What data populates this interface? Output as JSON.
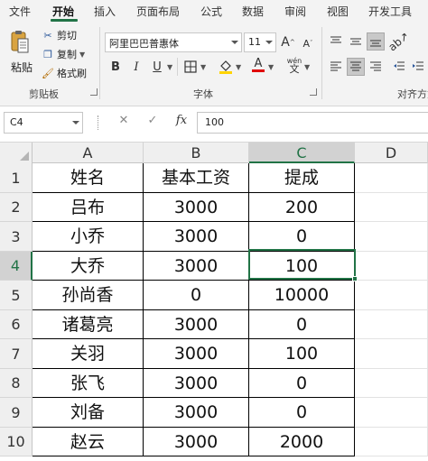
{
  "ribbon_tabs": [
    "文件",
    "开始",
    "插入",
    "页面布局",
    "公式",
    "数据",
    "审阅",
    "视图",
    "开发工具"
  ],
  "active_tab": "开始",
  "clipboard": {
    "paste_label": "粘贴",
    "cut_label": "剪切",
    "copy_label": "复制",
    "format_painter_label": "格式刷",
    "group_label": "剪贴板"
  },
  "font": {
    "font_name": "阿里巴巴普惠体",
    "font_size": "11",
    "grow_label": "A",
    "shrink_label": "A",
    "bold": "B",
    "italic": "I",
    "underline": "U",
    "font_color_label": "A",
    "phonetic_label": "wén",
    "group_label": "字体"
  },
  "alignment": {
    "group_label": "对齐方式"
  },
  "formula_bar": {
    "name_box": "C4",
    "cancel_glyph": "✕",
    "enter_glyph": "✓",
    "fx_glyph": "fx",
    "value": "100"
  },
  "columns": [
    "A",
    "B",
    "C",
    "D"
  ],
  "active_column": "C",
  "row_numbers": [
    "1",
    "2",
    "3",
    "4",
    "5",
    "6",
    "7",
    "8",
    "9",
    "10"
  ],
  "active_row": "4",
  "table": {
    "rows": [
      [
        "姓名",
        "基本工资",
        "提成"
      ],
      [
        "吕布",
        "3000",
        "200"
      ],
      [
        "小乔",
        "3000",
        "0"
      ],
      [
        "大乔",
        "3000",
        "100"
      ],
      [
        "孙尚香",
        "0",
        "10000"
      ],
      [
        "诸葛亮",
        "3000",
        "0"
      ],
      [
        "关羽",
        "3000",
        "100"
      ],
      [
        "张飞",
        "3000",
        "0"
      ],
      [
        "刘备",
        "3000",
        "0"
      ],
      [
        "赵云",
        "3000",
        "2000"
      ]
    ]
  },
  "colors": {
    "accent_green": "#217346",
    "header_bg": "#efefef",
    "ribbon_bg": "#f3f3f3"
  }
}
